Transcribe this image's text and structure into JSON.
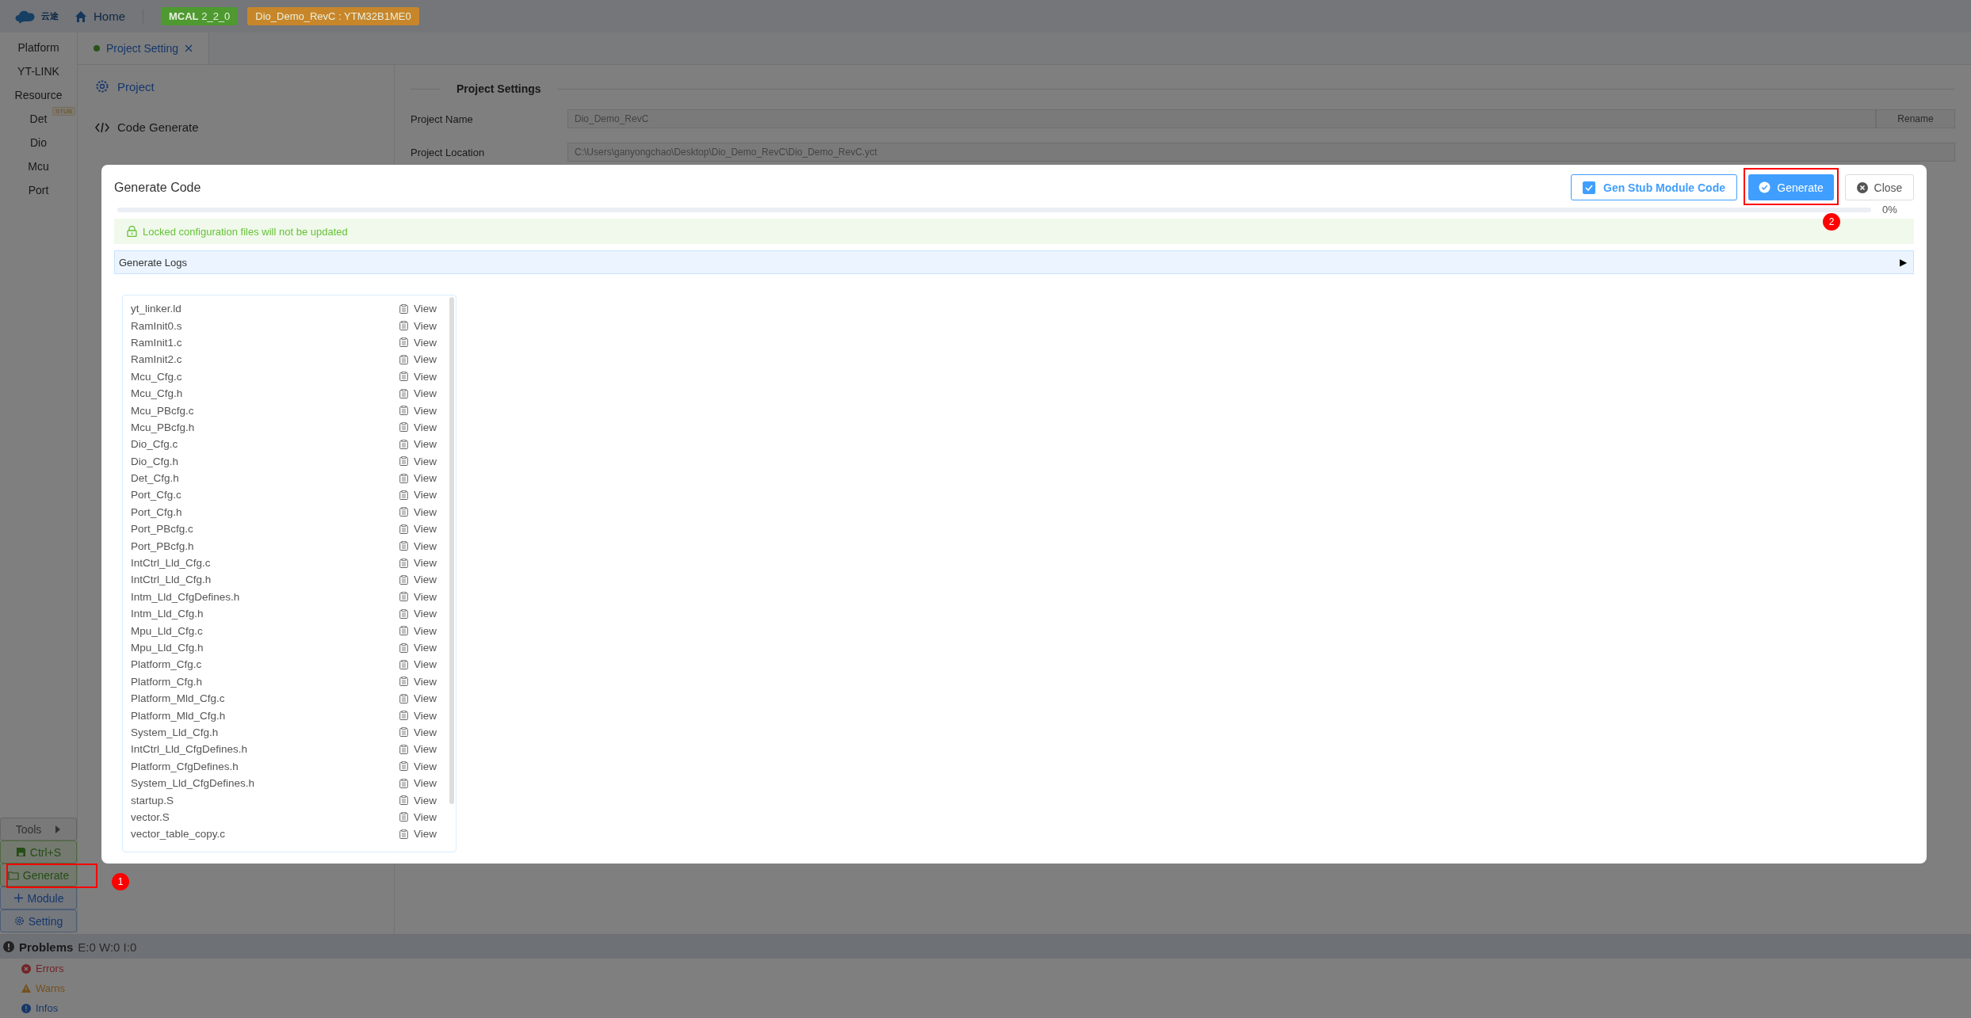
{
  "header": {
    "logo_text": "云途",
    "home": "Home",
    "tags": [
      {
        "label": "**MCAL** 2_2_0",
        "color": "#4e9a30"
      },
      {
        "label": "Dio_Demo_RevC : YTM32B1ME0",
        "color": "#c8862a"
      }
    ]
  },
  "sidebar": {
    "items": [
      {
        "label": "Platform"
      },
      {
        "label": "YT-LINK"
      },
      {
        "label": "Resource"
      },
      {
        "label": "Det",
        "badge": "STUB"
      },
      {
        "label": "Dio"
      },
      {
        "label": "Mcu"
      },
      {
        "label": "Port"
      }
    ],
    "actions": [
      {
        "kind": "tools",
        "label": "Tools"
      },
      {
        "kind": "save",
        "label": "Ctrl+S"
      },
      {
        "kind": "generate",
        "label": "Generate",
        "marker": "1"
      },
      {
        "kind": "module",
        "label": "Module"
      },
      {
        "kind": "setting",
        "label": "Setting"
      }
    ]
  },
  "tabs": [
    {
      "label": "Project Setting",
      "selected": true
    }
  ],
  "nav": [
    {
      "kind": "gear",
      "label": "Project",
      "selected": true
    },
    {
      "kind": "code",
      "label": "Code Generate",
      "selected": false
    }
  ],
  "settings": {
    "title": "Project Settings",
    "fields": [
      {
        "label": "Project Name",
        "value": "Dio_Demo_RevC",
        "button": "Rename"
      },
      {
        "label": "Project Location",
        "value": "C:\\Users\\ganyongchao\\Desktop\\Dio_Demo_RevC\\Dio_Demo_RevC.yct"
      }
    ]
  },
  "problems": {
    "title": "Problems",
    "counts": "E:0 W:0 I:0",
    "items": [
      {
        "kind": "error",
        "label": "Errors"
      },
      {
        "kind": "warn",
        "label": "Warns"
      },
      {
        "kind": "info",
        "label": "Infos"
      }
    ]
  },
  "dialog": {
    "title": "Generate Code",
    "stub_option": {
      "label": "Gen Stub Module Code",
      "checked": true
    },
    "generate_button": {
      "label": "Generate",
      "marker": "2"
    },
    "close_button": "Close",
    "progress": {
      "level": 0,
      "reading": "0%"
    },
    "alert": "Locked configuration files will not be updated",
    "logs": {
      "label": "Generate Logs",
      "expanded": false,
      "arrow": "▶"
    },
    "files": [
      {
        "name": "yt_linker.ld",
        "action": "View"
      },
      {
        "name": "RamInit0.s",
        "action": "View"
      },
      {
        "name": "RamInit1.c",
        "action": "View"
      },
      {
        "name": "RamInit2.c",
        "action": "View"
      },
      {
        "name": "Mcu_Cfg.c",
        "action": "View"
      },
      {
        "name": "Mcu_Cfg.h",
        "action": "View"
      },
      {
        "name": "Mcu_PBcfg.c",
        "action": "View"
      },
      {
        "name": "Mcu_PBcfg.h",
        "action": "View"
      },
      {
        "name": "Dio_Cfg.c",
        "action": "View"
      },
      {
        "name": "Dio_Cfg.h",
        "action": "View"
      },
      {
        "name": "Det_Cfg.h",
        "action": "View"
      },
      {
        "name": "Port_Cfg.c",
        "action": "View"
      },
      {
        "name": "Port_Cfg.h",
        "action": "View"
      },
      {
        "name": "Port_PBcfg.c",
        "action": "View"
      },
      {
        "name": "Port_PBcfg.h",
        "action": "View"
      },
      {
        "name": "IntCtrl_Lld_Cfg.c",
        "action": "View"
      },
      {
        "name": "IntCtrl_Lld_Cfg.h",
        "action": "View"
      },
      {
        "name": "Intm_Lld_CfgDefines.h",
        "action": "View"
      },
      {
        "name": "Intm_Lld_Cfg.h",
        "action": "View"
      },
      {
        "name": "Mpu_Lld_Cfg.c",
        "action": "View"
      },
      {
        "name": "Mpu_Lld_Cfg.h",
        "action": "View"
      },
      {
        "name": "Platform_Cfg.c",
        "action": "View"
      },
      {
        "name": "Platform_Cfg.h",
        "action": "View"
      },
      {
        "name": "Platform_Mld_Cfg.c",
        "action": "View"
      },
      {
        "name": "Platform_Mld_Cfg.h",
        "action": "View"
      },
      {
        "name": "System_Lld_Cfg.h",
        "action": "View"
      },
      {
        "name": "IntCtrl_Lld_CfgDefines.h",
        "action": "View"
      },
      {
        "name": "Platform_CfgDefines.h",
        "action": "View"
      },
      {
        "name": "System_Lld_CfgDefines.h",
        "action": "View"
      },
      {
        "name": "startup.S",
        "action": "View"
      },
      {
        "name": "vector.S",
        "action": "View"
      },
      {
        "name": "vector_table_copy.c",
        "action": "View"
      }
    ]
  }
}
